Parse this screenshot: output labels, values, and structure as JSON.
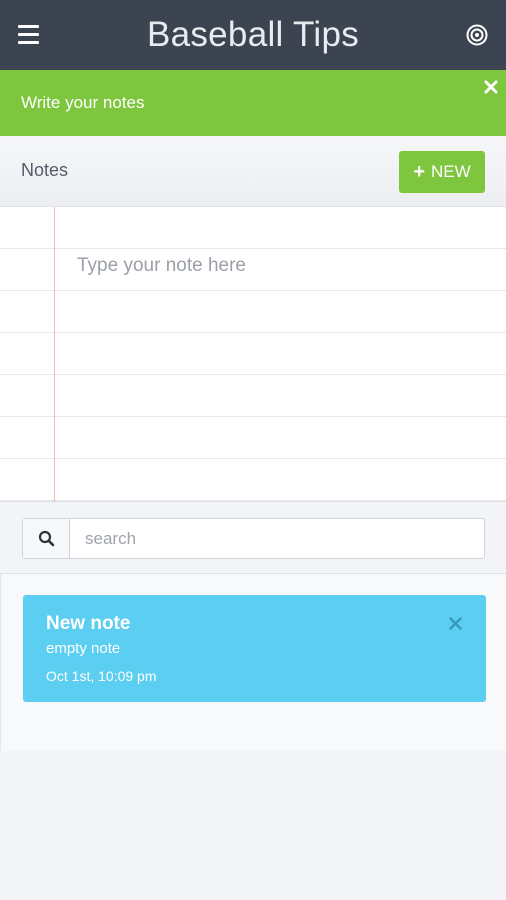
{
  "app": {
    "title": "Baseball Tips",
    "menu_icon": "hamburger-menu-icon",
    "action_icon": "target-icon"
  },
  "banner": {
    "text": "Write your notes",
    "close_icon": "close-icon",
    "color": "#7dc63d"
  },
  "notes_header": {
    "title": "Notes",
    "new_button_label": "NEW",
    "new_button_icon": "plus-icon"
  },
  "editor": {
    "placeholder": "Type your note here"
  },
  "search": {
    "placeholder": "search",
    "value": "",
    "icon": "search-icon"
  },
  "notes": [
    {
      "title": "New note",
      "preview": "empty note",
      "date": "Oct 1st, 10:09 pm",
      "color": "#5bcef2"
    }
  ],
  "colors": {
    "topbar": "#3d4451",
    "accent_green": "#7dc63d",
    "note_blue": "#5bcef2",
    "margin_red": "#f2b8b2"
  }
}
